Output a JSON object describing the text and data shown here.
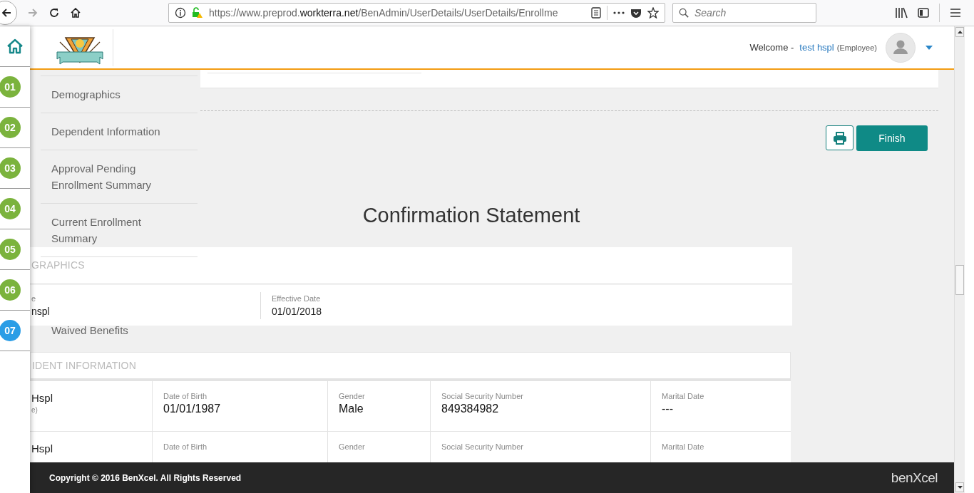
{
  "browser": {
    "url_prefix": "https://www.preprod.",
    "url_domain": "workterra.net",
    "url_path": "/BenAdmin/UserDetails/UserDetails/Enrollme",
    "search_placeholder": "Search",
    "forward_disabled": true
  },
  "steps": [
    {
      "label": "01",
      "selected": false
    },
    {
      "label": "02",
      "selected": false
    },
    {
      "label": "03",
      "selected": false
    },
    {
      "label": "04",
      "selected": false
    },
    {
      "label": "05",
      "selected": false
    },
    {
      "label": "06",
      "selected": false
    },
    {
      "label": "07",
      "selected": true
    }
  ],
  "header": {
    "welcome": "Welcome -",
    "user": "test hspl",
    "role": "(Employee)"
  },
  "menu": [
    {
      "label": "Demographics",
      "gap": false
    },
    {
      "label": "Dependent Information",
      "gap": false
    },
    {
      "label": "Approval Pending Enrollment Summary",
      "gap": false
    },
    {
      "label": "Current Enrollment Summary",
      "gap": false
    },
    {
      "label": "Waived Benefits",
      "gap": true
    }
  ],
  "finish_button": "Finish",
  "title": "Confirmation Statement",
  "demographics": {
    "heading": "GRAPHICS",
    "fields": [
      {
        "label": "e",
        "value": "nspl"
      },
      {
        "label": "Effective Date",
        "value": "01/01/2018"
      }
    ]
  },
  "dependents": {
    "heading": "IDENT INFORMATION",
    "rows": [
      {
        "name": "Hspl",
        "relation": "e)",
        "cells": [
          {
            "label": "Date of Birth",
            "value": "01/01/1987"
          },
          {
            "label": "Gender",
            "value": "Male"
          },
          {
            "label": "Social Security Number",
            "value": "849384982"
          },
          {
            "label": "Marital Date",
            "value": "---"
          }
        ]
      },
      {
        "name": "Hspl",
        "cells": [
          {
            "label": "Date of Birth"
          },
          {
            "label": "Gender"
          },
          {
            "label": "Social Security Number"
          },
          {
            "label": "Marital Date"
          }
        ]
      }
    ]
  },
  "footer": {
    "copyright": "Copyright © 2016 BenXcel. All Rights Reserved",
    "logo": "benXcel"
  }
}
